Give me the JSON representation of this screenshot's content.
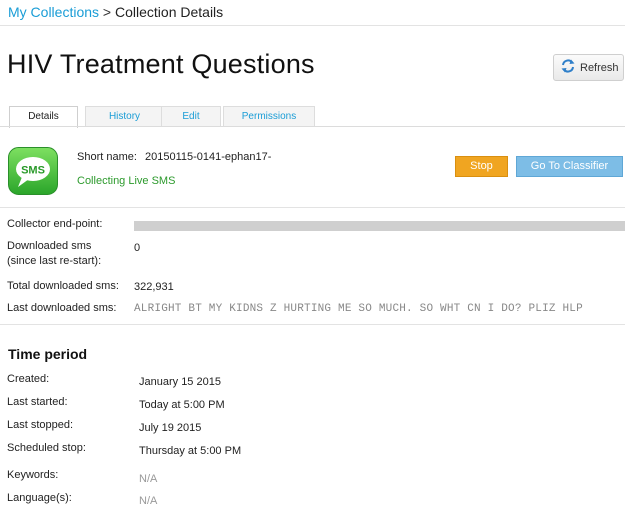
{
  "breadcrumb": {
    "root": "My Collections",
    "separator": ">",
    "current": "Collection Details"
  },
  "page": {
    "title": "HIV Treatment Questions",
    "refresh_label": "Refresh"
  },
  "tabs": [
    {
      "label": "Details",
      "active": true
    },
    {
      "label": "History",
      "active": false
    },
    {
      "label": "Edit",
      "active": false
    },
    {
      "label": "Permissions",
      "active": false
    }
  ],
  "collection": {
    "icon_text": "SMS",
    "icon": "sms-bubble-icon",
    "short_name_label": "Short name:",
    "short_name": "20150115-0141-ephan17-",
    "status": "Collecting Live SMS",
    "stop_label": "Stop",
    "classifier_label": "Go To Classifier"
  },
  "stats": {
    "endpoint_label": "Collector end-point:",
    "downloaded_label_1": "Downloaded sms",
    "downloaded_label_2": "(since last re-start):",
    "downloaded_value": "0",
    "total_label": "Total downloaded sms:",
    "total_value": "322,931",
    "last_label": "Last downloaded sms:",
    "last_value": "ALRIGHT BT MY KIDNS Z HURTING ME SO MUCH. SO WHT CN I DO? PLIZ HLP"
  },
  "time_period": {
    "title": "Time period",
    "created_label": "Created:",
    "created_value": "January 15 2015",
    "last_started_label": "Last started:",
    "last_started_value": "Today at 5:00 PM",
    "last_stopped_label": "Last stopped:",
    "last_stopped_value": "July 19 2015",
    "scheduled_stop_label": "Scheduled stop:",
    "scheduled_stop_value": "Thursday at 5:00 PM",
    "keywords_label": "Keywords:",
    "keywords_value": "N/A",
    "languages_label": "Language(s):",
    "languages_value": "N/A"
  },
  "colors": {
    "link": "#1a9dd6",
    "status_green": "#2c9a2c",
    "stop_orange": "#f0a521",
    "classifier_blue": "#7dbde6"
  }
}
